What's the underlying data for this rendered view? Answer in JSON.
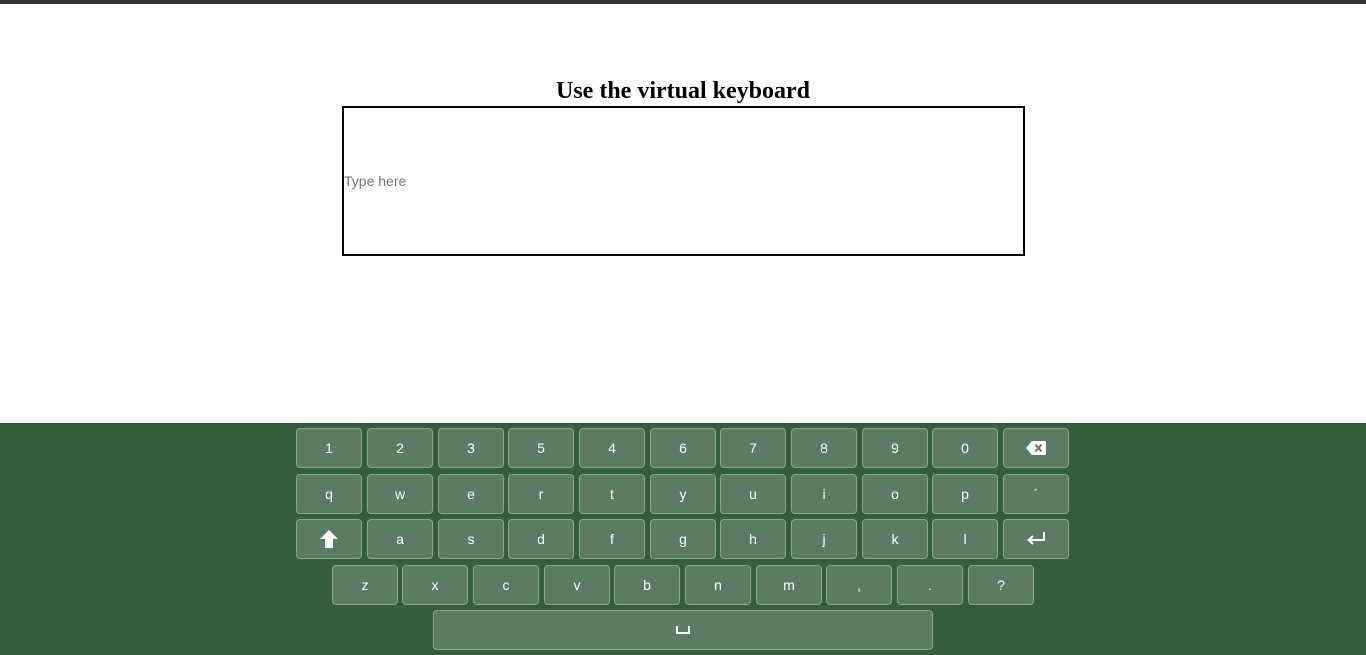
{
  "page": {
    "title": "Use the virtual keyboard"
  },
  "text_area": {
    "placeholder": "Type here"
  },
  "keyboard": {
    "row1": [
      "1",
      "2",
      "3",
      "5",
      "4",
      "6",
      "7",
      "8",
      "9",
      "0"
    ],
    "row1_end_icon": "backspace-icon",
    "row2": [
      "q",
      "w",
      "e",
      "r",
      "t",
      "y",
      "u",
      "i",
      "o",
      "p",
      "´"
    ],
    "row3_start_icon": "shift-icon",
    "row3": [
      "a",
      "s",
      "d",
      "f",
      "g",
      "h",
      "j",
      "k",
      "l"
    ],
    "row3_end_icon": "enter-icon",
    "row4": [
      "z",
      "x",
      "c",
      "v",
      "b",
      "n",
      "m",
      ",",
      ".",
      "?"
    ],
    "space_icon": "space-icon",
    "colors": {
      "background": "#365c3f",
      "key": "#5c7a64",
      "key_border": "#8aa592"
    }
  }
}
